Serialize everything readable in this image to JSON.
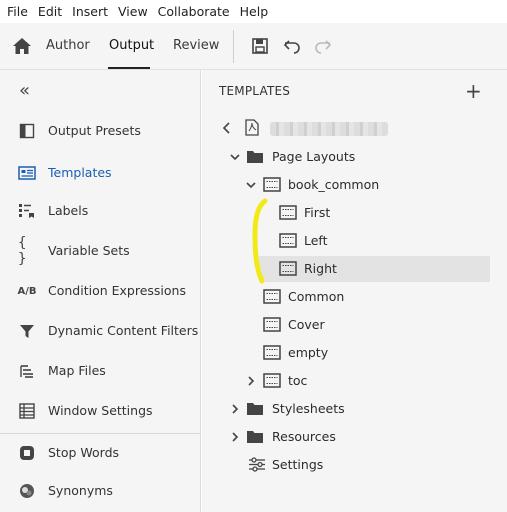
{
  "menu": [
    "File",
    "Edit",
    "Insert",
    "View",
    "Collaborate",
    "Help"
  ],
  "toolbar": {
    "tabs": [
      "Author",
      "Output",
      "Review"
    ],
    "active_tab": "Output",
    "icons": [
      "home-icon",
      "save-icon",
      "undo-icon",
      "redo-icon"
    ]
  },
  "left_panel": {
    "items": [
      {
        "label": "Output Presets",
        "icon": "output-presets-icon"
      },
      {
        "label": "Templates",
        "icon": "templates-icon",
        "active": true
      },
      {
        "label": "Labels",
        "icon": "labels-icon"
      },
      {
        "label": "Variable Sets",
        "icon": "variable-sets-icon"
      },
      {
        "label": "Condition Expressions",
        "icon": "ab-icon",
        "glyph": "A/B"
      },
      {
        "label": "Dynamic Content Filters",
        "icon": "filter-icon"
      },
      {
        "label": "Map Files",
        "icon": "map-files-icon"
      },
      {
        "label": "Window Settings",
        "icon": "window-settings-icon"
      },
      {
        "label": "Stop Words",
        "icon": "stop-words-icon"
      },
      {
        "label": "Synonyms",
        "icon": "synonyms-icon"
      }
    ],
    "colors": {
      "active": "#1a5fb4"
    }
  },
  "right_panel": {
    "header": "TEMPLATES",
    "tree": {
      "page_layouts": "Page Layouts",
      "book_common": "book_common",
      "first": "First",
      "left": "Left",
      "right": "Right",
      "common": "Common",
      "cover": "Cover",
      "empty": "empty",
      "toc": "toc",
      "stylesheets": "Stylesheets",
      "resources": "Resources",
      "settings": "Settings"
    },
    "selected": "Right",
    "annotation_color": "#f2ea18"
  }
}
